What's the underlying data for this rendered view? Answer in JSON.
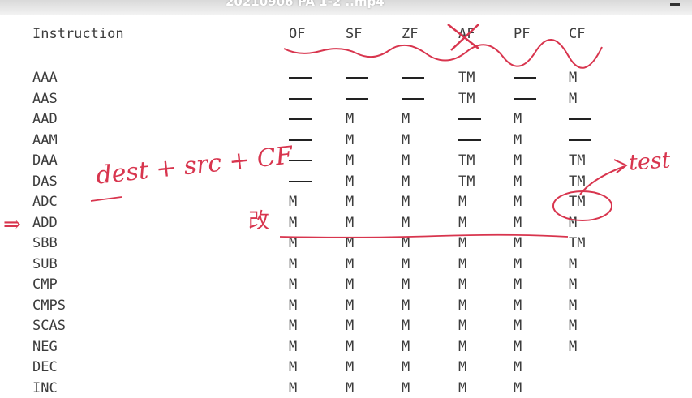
{
  "window": {
    "title": "20210906 PA 1-2 ..mp4"
  },
  "table": {
    "headers": [
      "Instruction",
      "OF",
      "SF",
      "ZF",
      "AF",
      "PF",
      "CF"
    ],
    "rows": [
      {
        "name": "AAA",
        "flags": [
          "—",
          "—",
          "—",
          "TM",
          "—",
          "M"
        ]
      },
      {
        "name": "AAS",
        "flags": [
          "—",
          "—",
          "—",
          "TM",
          "—",
          "M"
        ]
      },
      {
        "name": "AAD",
        "flags": [
          "—",
          "M",
          "M",
          "—",
          "M",
          "—"
        ]
      },
      {
        "name": "AAM",
        "flags": [
          "—",
          "M",
          "M",
          "—",
          "M",
          "—"
        ]
      },
      {
        "name": "DAA",
        "flags": [
          "—",
          "M",
          "M",
          "TM",
          "M",
          "TM"
        ]
      },
      {
        "name": "DAS",
        "flags": [
          "—",
          "M",
          "M",
          "TM",
          "M",
          "TM"
        ]
      },
      {
        "name": "ADC",
        "flags": [
          "M",
          "M",
          "M",
          "M",
          "M",
          "TM"
        ]
      },
      {
        "name": "ADD",
        "flags": [
          "M",
          "M",
          "M",
          "M",
          "M",
          "M"
        ]
      },
      {
        "name": "SBB",
        "flags": [
          "M",
          "M",
          "M",
          "M",
          "M",
          "TM"
        ]
      },
      {
        "name": "SUB",
        "flags": [
          "M",
          "M",
          "M",
          "M",
          "M",
          "M"
        ]
      },
      {
        "name": "CMP",
        "flags": [
          "M",
          "M",
          "M",
          "M",
          "M",
          "M"
        ]
      },
      {
        "name": "CMPS",
        "flags": [
          "M",
          "M",
          "M",
          "M",
          "M",
          "M"
        ]
      },
      {
        "name": "SCAS",
        "flags": [
          "M",
          "M",
          "M",
          "M",
          "M",
          "M"
        ]
      },
      {
        "name": "NEG",
        "flags": [
          "M",
          "M",
          "M",
          "M",
          "M",
          "M"
        ]
      },
      {
        "name": "DEC",
        "flags": [
          "M",
          "M",
          "M",
          "M",
          "M",
          ""
        ]
      },
      {
        "name": "INC",
        "flags": [
          "M",
          "M",
          "M",
          "M",
          "M",
          ""
        ]
      }
    ]
  },
  "annotations": {
    "dest_src": "dest + src + CF",
    "test": "test",
    "gai": "改",
    "arrow": "⇒"
  },
  "colors": {
    "ink": "#d8354e",
    "text": "#3c3c3c"
  }
}
